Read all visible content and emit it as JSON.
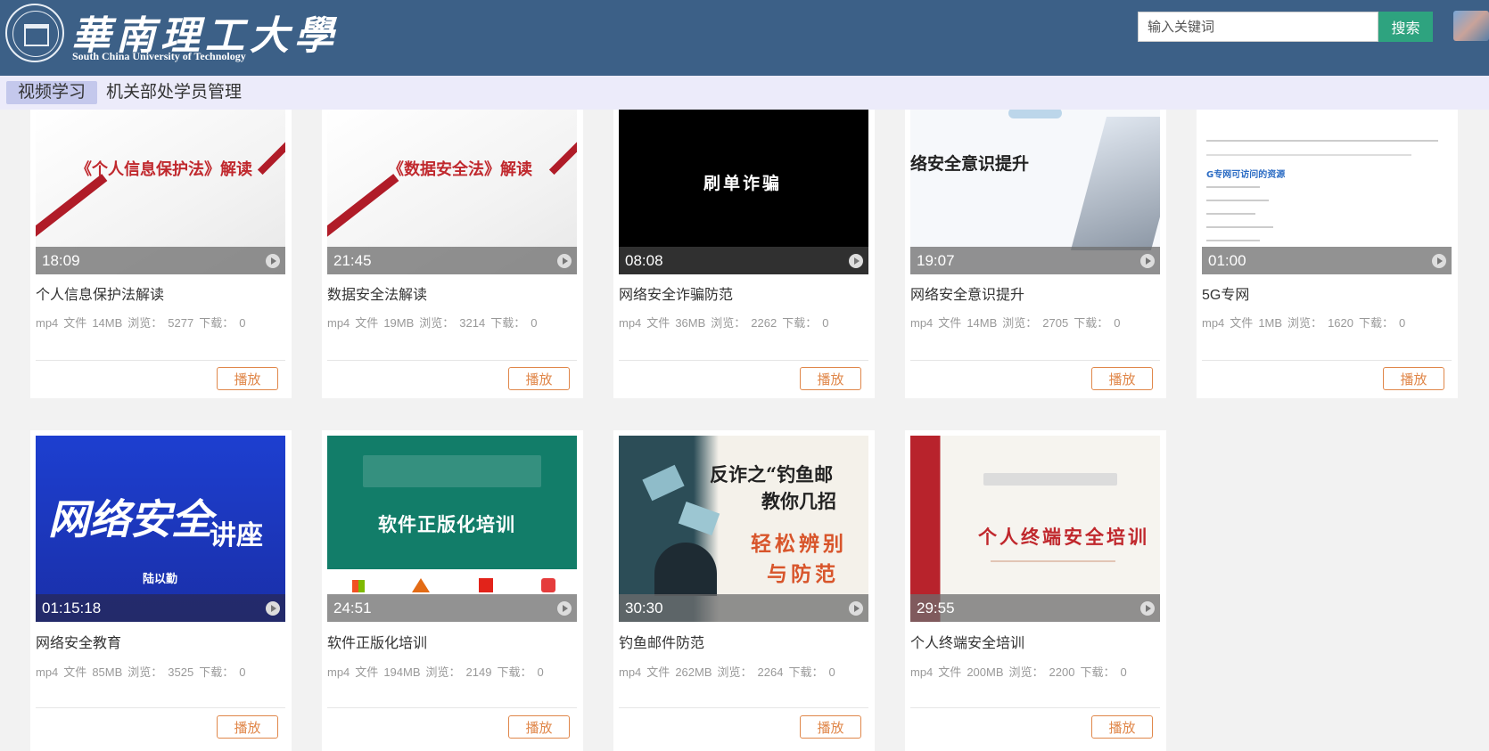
{
  "header": {
    "logo_cn": "華南理工大學",
    "logo_en": "South China University of Technology",
    "search_placeholder": "输入关键词",
    "search_button": "搜索"
  },
  "nav": {
    "tabs": [
      {
        "label": "视频学习",
        "active": true
      },
      {
        "label": "机关部处学员管理",
        "active": false
      }
    ]
  },
  "labels": {
    "type_suffix": "文件",
    "views": "浏览：",
    "downloads": "下载：",
    "play": "播放"
  },
  "videos": [
    {
      "title": "个人信息保护法解读",
      "duration": "18:09",
      "format": "mp4",
      "size": "14MB",
      "views": "5277",
      "downloads": "0",
      "thumb_text": "《个人信息保护法》解读"
    },
    {
      "title": "数据安全法解读",
      "duration": "21:45",
      "format": "mp4",
      "size": "19MB",
      "views": "3214",
      "downloads": "0",
      "thumb_text": "《数据安全法》解读"
    },
    {
      "title": "网络安全诈骗防范",
      "duration": "08:08",
      "format": "mp4",
      "size": "36MB",
      "views": "2262",
      "downloads": "0",
      "thumb_text": "刷单诈骗"
    },
    {
      "title": "网络安全意识提升",
      "duration": "19:07",
      "format": "mp4",
      "size": "14MB",
      "views": "2705",
      "downloads": "0",
      "thumb_text": "络安全意识提升"
    },
    {
      "title": "5G专网",
      "duration": "01:00",
      "format": "mp4",
      "size": "1MB",
      "views": "1620",
      "downloads": "0",
      "thumb_text": "G专网可访问的资源"
    },
    {
      "title": "网络安全教育",
      "duration": "01:15:18",
      "format": "mp4",
      "size": "85MB",
      "views": "3525",
      "downloads": "0",
      "thumb_text": "网络安全",
      "thumb_text2": "讲座",
      "thumb_text3": "陆以勤"
    },
    {
      "title": "软件正版化培训",
      "duration": "24:51",
      "format": "mp4",
      "size": "194MB",
      "views": "2149",
      "downloads": "0",
      "thumb_text": "软件正版化培训"
    },
    {
      "title": "钓鱼邮件防范",
      "duration": "30:30",
      "format": "mp4",
      "size": "262MB",
      "views": "2264",
      "downloads": "0",
      "thumb_text": "反诈之“钓鱼邮",
      "thumb_text2": "教你几招",
      "thumb_text3": "轻松辨别",
      "thumb_text4": "与防范"
    },
    {
      "title": "个人终端安全培训",
      "duration": "29:55",
      "format": "mp4",
      "size": "200MB",
      "views": "2200",
      "downloads": "0",
      "thumb_text": "个人终端安全培训"
    }
  ]
}
